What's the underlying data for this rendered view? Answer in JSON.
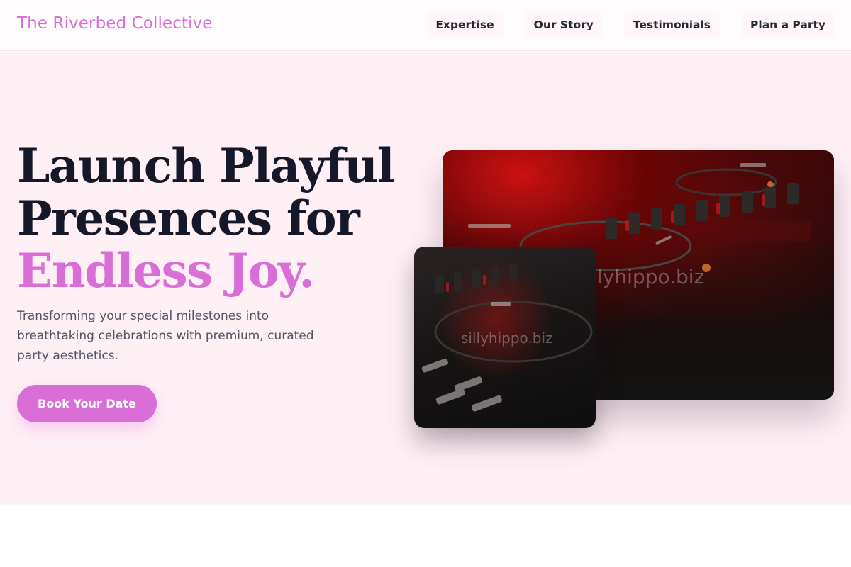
{
  "header": {
    "brand": "The Riverbed Collective",
    "nav": [
      "Expertise",
      "Our Story",
      "Testimonials",
      "Plan a Party"
    ]
  },
  "hero": {
    "headline_line1": "Launch Playful",
    "headline_line2": "Presences for",
    "headline_line3": "Endless Joy.",
    "subtitle": "Transforming your special milestones into breathtaking celebrations with premium, curated party aesthetics.",
    "cta": "Book Your Date",
    "watermark_big": "lyhippo.biz",
    "watermark_small": "sillyhippo.biz"
  },
  "colors": {
    "accent": "#d96fd6",
    "hero_bg": "#fff0f6",
    "text_dark": "#141829"
  }
}
